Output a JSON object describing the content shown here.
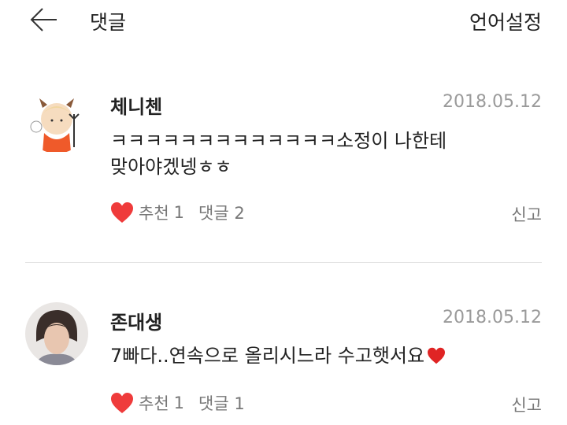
{
  "header": {
    "title": "댓글",
    "language_setting": "언어설정"
  },
  "comments": [
    {
      "author": "체니첸",
      "date": "2018.05.12",
      "text_line1": "ㅋㅋㅋㅋㅋㅋㅋㅋㅋㅋㅋㅋㅋ소정이 나한테",
      "text_line2": "맞아야겠넹ㅎㅎ",
      "like_label": "추천",
      "like_count": "1",
      "reply_label": "댓글 2",
      "report_label": "신고"
    },
    {
      "author": "존대생",
      "date": "2018.05.12",
      "text_line1": "7빠다..연속으로 올리시느라 수고햇서요",
      "like_label": "추천",
      "like_count": "1",
      "reply_label": "댓글 1",
      "report_label": "신고"
    }
  ],
  "colors": {
    "heart": "#ef3b3b",
    "muted_text": "#777777",
    "date_text": "#9a9a9a",
    "divider": "#e3e3e3"
  },
  "icons": {
    "back": "back-arrow-icon",
    "like": "heart-icon",
    "emoji": "red-heart-emoji-icon"
  }
}
